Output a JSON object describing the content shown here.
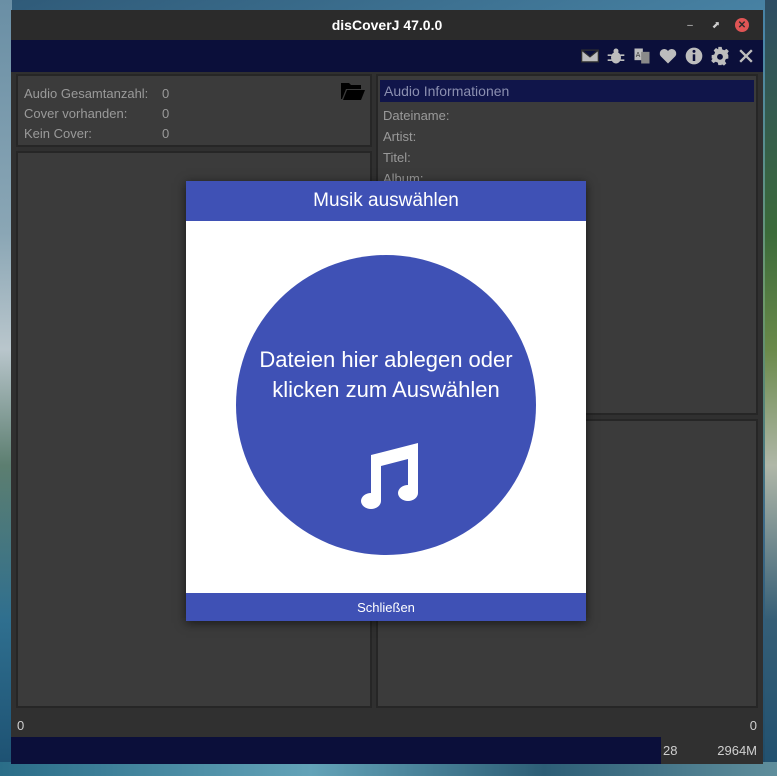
{
  "window": {
    "title": "disCoverJ 47.0.0",
    "controls": {
      "minimize": "–",
      "maximize": "⬈",
      "close": "✕"
    }
  },
  "toolbar": {
    "icons": [
      "envelope-icon",
      "bug-icon",
      "translate-icon",
      "heart-icon",
      "info-icon",
      "gear-icon",
      "close-icon"
    ]
  },
  "stats": {
    "rows": [
      {
        "label": "Audio Gesamtanzahl:",
        "value": "0"
      },
      {
        "label": "Cover vorhanden:",
        "value": "0"
      },
      {
        "label": "Kein Cover:",
        "value": "0"
      }
    ]
  },
  "info": {
    "header": "Audio Informationen",
    "fields": [
      "Dateiname:",
      "Artist:",
      "Titel:",
      "Album:"
    ]
  },
  "status": {
    "left": "0",
    "right": "0"
  },
  "memory": {
    "used": "28",
    "total": "2964M"
  },
  "dialog": {
    "title": "Musik auswählen",
    "drop_text": "Dateien hier ablegen oder klicken zum Auswählen",
    "close_label": "Schließen"
  },
  "colors": {
    "accent": "#3f51b5",
    "toolbar_bg": "#0b0f3a",
    "window_bg": "#303030"
  }
}
